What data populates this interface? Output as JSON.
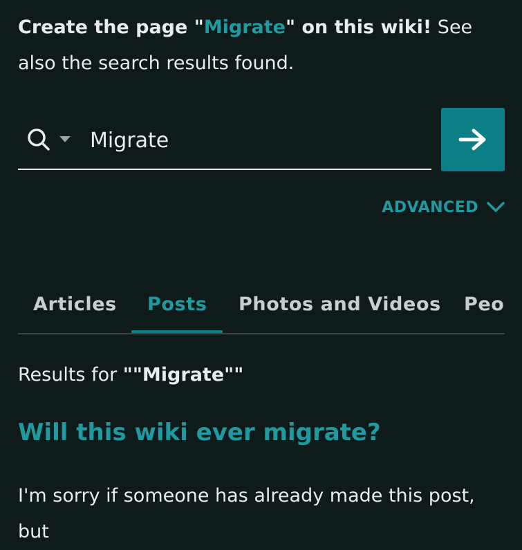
{
  "create_notice": {
    "prefix": "Create the page \"",
    "page_link": "Migrate",
    "suffix": "\" on this wiki!",
    "rest": " See also the search results found."
  },
  "search": {
    "value": "Migrate",
    "icon": "search-icon",
    "dropdown_icon": "caret-down-icon",
    "submit_icon": "arrow-right-icon"
  },
  "advanced": {
    "label": "ADVANCED",
    "icon": "chevron-down-icon"
  },
  "tabs": [
    {
      "label": "Articles",
      "active": false
    },
    {
      "label": "Posts",
      "active": true
    },
    {
      "label": "Photos and Videos",
      "active": false
    },
    {
      "label": "Peo",
      "active": false
    }
  ],
  "results": {
    "prefix": "Results for ",
    "query": "\"\"Migrate\"\""
  },
  "result_item": {
    "title": "Will this wiki ever migrate?",
    "snippet": "I'm sorry if someone has already made this post, but"
  },
  "colors": {
    "background": "#0f1a1b",
    "accent": "#1f9aa1",
    "button": "#0b7e86",
    "text": "#e8ecec"
  }
}
